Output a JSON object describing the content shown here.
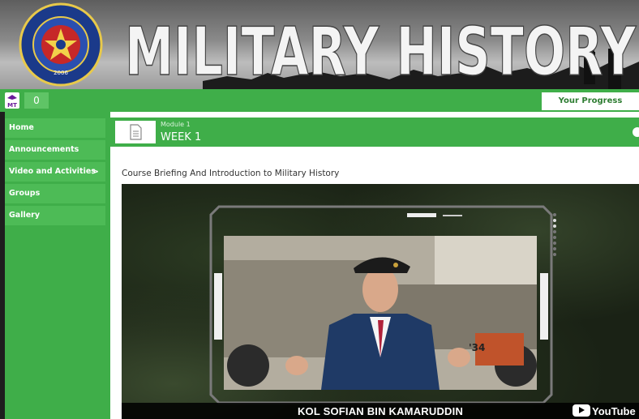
{
  "banner": {
    "title": "MILITARY HISTORY",
    "crest_text_top": "UNIVERSITI PERTAHANAN NASIONAL MALAYSIA",
    "crest_year": "2006",
    "crest_motto": "UPNM"
  },
  "appbar": {
    "logo_text": "MT",
    "counter": "0",
    "progress_label": "Your Progress"
  },
  "sidebar": {
    "items": [
      {
        "label": "Home"
      },
      {
        "label": "Announcements"
      },
      {
        "label": "Video and Activities",
        "chevron": ">"
      },
      {
        "label": "Groups"
      },
      {
        "label": "Gallery"
      }
    ]
  },
  "module": {
    "kicker": "Module 1",
    "title": "WEEK 1",
    "icon": "document-icon"
  },
  "course": {
    "title": "Course Briefing And Introduction to Military History"
  },
  "video": {
    "caption": "KOL SOFIAN BIN KAMARUDDIN",
    "tag": "'34",
    "player_brand": "YouTube"
  },
  "colors": {
    "primary_green": "#3fae49",
    "sidebar_item": "#4dbb56"
  }
}
